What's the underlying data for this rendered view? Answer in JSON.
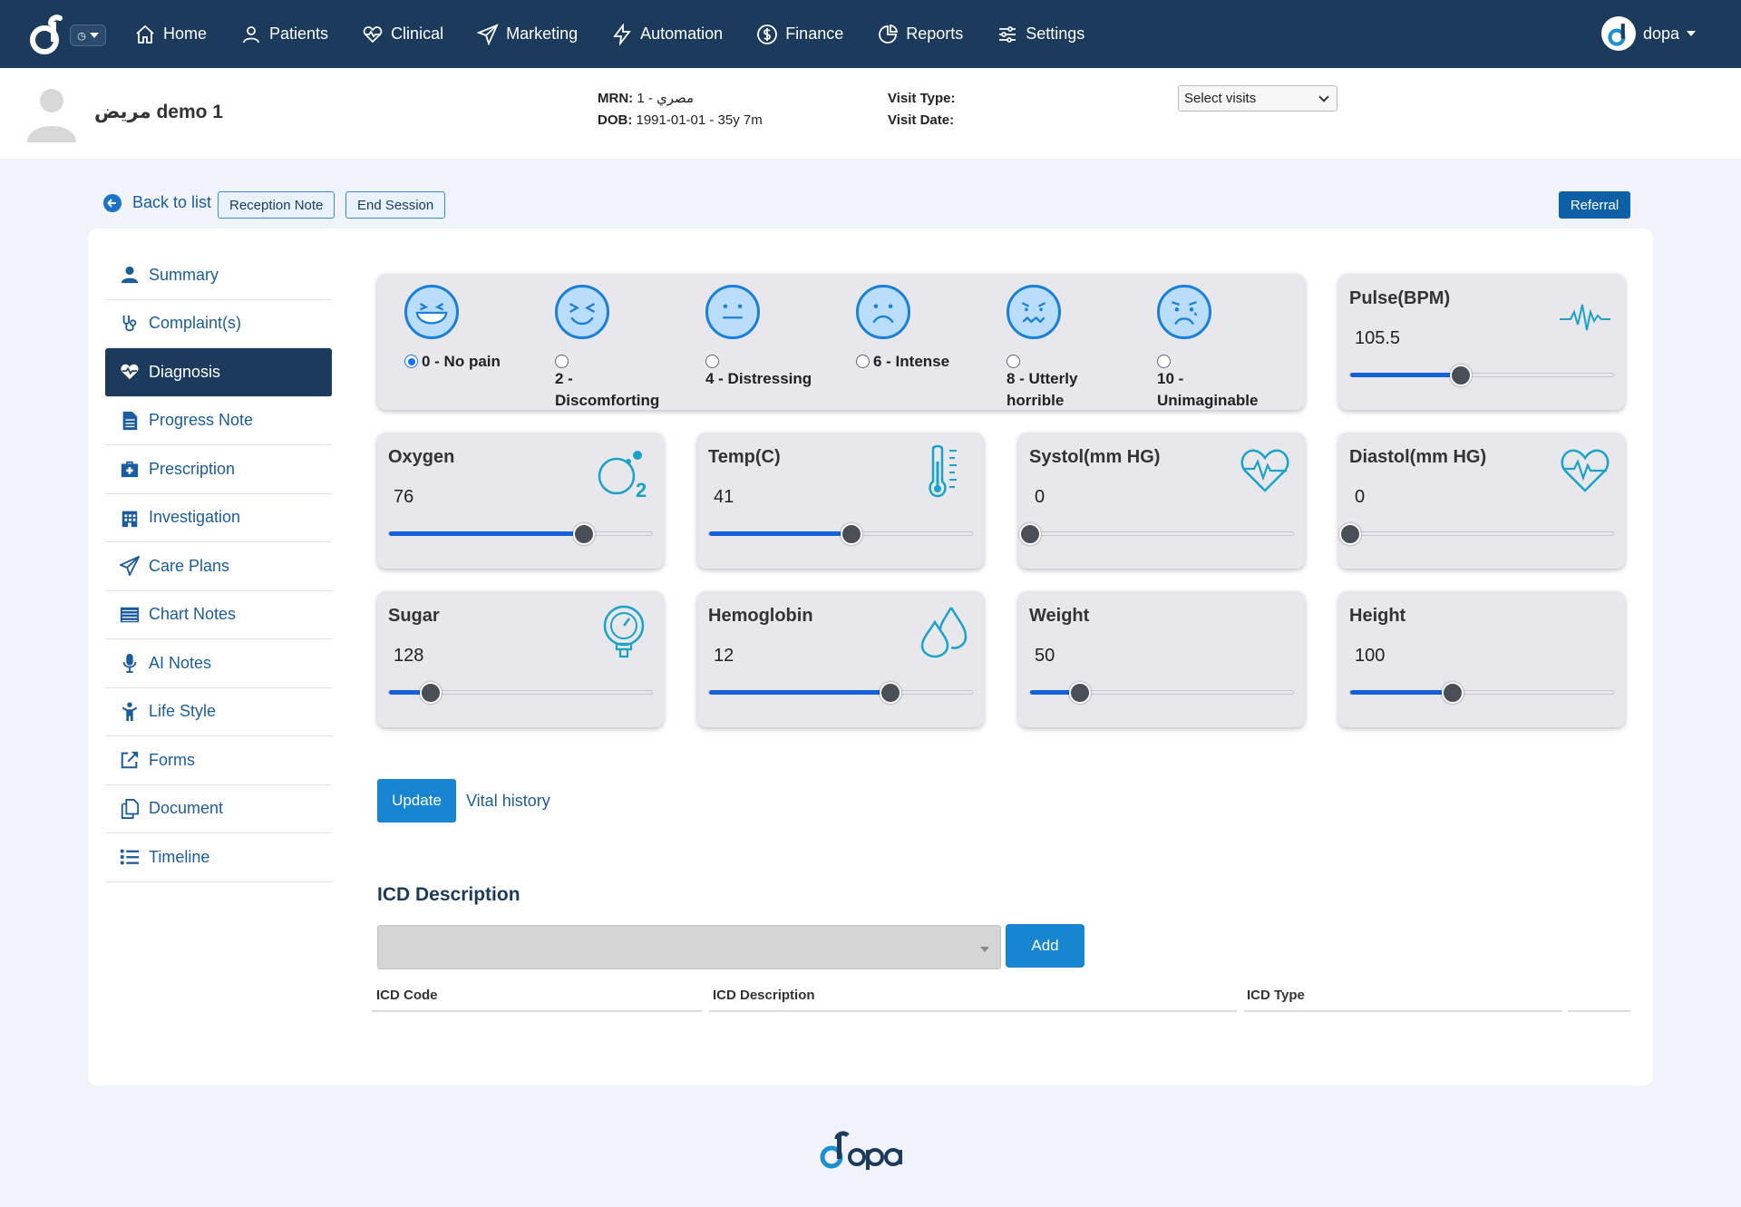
{
  "nav": {
    "items": [
      {
        "label": "Home",
        "icon": "home-icon"
      },
      {
        "label": "Patients",
        "icon": "user-icon"
      },
      {
        "label": "Clinical",
        "icon": "heart-pulse-icon"
      },
      {
        "label": "Marketing",
        "icon": "paper-plane-icon"
      },
      {
        "label": "Automation",
        "icon": "bolt-icon"
      },
      {
        "label": "Finance",
        "icon": "dollar-icon"
      },
      {
        "label": "Reports",
        "icon": "pie-chart-icon"
      },
      {
        "label": "Settings",
        "icon": "sliders-icon"
      }
    ],
    "user": "dopa"
  },
  "patient": {
    "name": "مريض demo 1",
    "mrn_label": "MRN:",
    "mrn_value": "1 - مصري",
    "dob_label": "DOB:",
    "dob_value": "1991-01-01 - 35y 7m",
    "visit_type_label": "Visit Type:",
    "visit_date_label": "Visit Date:",
    "visit_select": "Select visits"
  },
  "actions": {
    "back": "Back to list",
    "reception_note": "Reception Note",
    "end_session": "End Session",
    "referral": "Referral"
  },
  "sidebar": {
    "items": [
      {
        "label": "Summary",
        "icon": "person-icon",
        "active": false
      },
      {
        "label": "Complaint(s)",
        "icon": "stethoscope-icon",
        "active": false
      },
      {
        "label": "Diagnosis",
        "icon": "heart-pulse-icon",
        "active": true
      },
      {
        "label": "Progress Note",
        "icon": "document-icon",
        "active": false
      },
      {
        "label": "Prescription",
        "icon": "medkit-icon",
        "active": false
      },
      {
        "label": "Investigation",
        "icon": "hospital-icon",
        "active": false
      },
      {
        "label": "Care Plans",
        "icon": "paper-plane-icon",
        "active": false
      },
      {
        "label": "Chart Notes",
        "icon": "list-box-icon",
        "active": false
      },
      {
        "label": "AI Notes",
        "icon": "microphone-icon",
        "active": false
      },
      {
        "label": "Life Style",
        "icon": "child-icon",
        "active": false
      },
      {
        "label": "Forms",
        "icon": "external-link-icon",
        "active": false
      },
      {
        "label": "Document",
        "icon": "copy-icon",
        "active": false
      },
      {
        "label": "Timeline",
        "icon": "list-icon",
        "active": false
      }
    ]
  },
  "pain_scale": {
    "selected": "0 - No pain",
    "options": [
      {
        "label": "0 - No pain",
        "line1": "0 - No pain",
        "line2": ""
      },
      {
        "label": "2 - Discomforting",
        "line1": "2 -",
        "line2": "Discomforting"
      },
      {
        "label": "4 - Distressing",
        "line1": "4 - Distressing",
        "line2": ""
      },
      {
        "label": "6 - Intense",
        "line1": "6 - Intense",
        "line2": ""
      },
      {
        "label": "8 - Utterly horrible",
        "line1": "8 - Utterly",
        "line2": "horrible"
      },
      {
        "label": "10 - Unimaginable",
        "line1": "10 -",
        "line2": "Unimaginable"
      }
    ]
  },
  "vitals": {
    "pulse": {
      "title": "Pulse(BPM)",
      "value": "105.5",
      "level": 0.42,
      "icon": "heartbeat-line-icon"
    },
    "oxygen": {
      "title": "Oxygen",
      "value": "76",
      "level": 0.74,
      "icon": "oxygen-o2-icon"
    },
    "temp": {
      "title": "Temp(C)",
      "value": "41",
      "level": 0.54,
      "icon": "thermometer-icon"
    },
    "systol": {
      "title": "Systol(mm HG)",
      "value": "0",
      "level": 0.0,
      "icon": "heart-rate-icon"
    },
    "diastol": {
      "title": "Diastol(mm HG)",
      "value": "0",
      "level": 0.0,
      "icon": "heart-rate-icon"
    },
    "sugar": {
      "title": "Sugar",
      "value": "128",
      "level": 0.16,
      "icon": "glucose-gauge-icon"
    },
    "hemoglobin": {
      "title": "Hemoglobin",
      "value": "12",
      "level": 0.69,
      "icon": "drops-icon"
    },
    "weight": {
      "title": "Weight",
      "value": "50",
      "level": 0.19,
      "icon": "none"
    },
    "height": {
      "title": "Height",
      "value": "100",
      "level": 0.39,
      "icon": "none"
    }
  },
  "buttons": {
    "update": "Update",
    "vital_history": "Vital history",
    "add": "Add"
  },
  "icd": {
    "title": "ICD Description",
    "columns": [
      "ICD Code",
      "ICD Description",
      "ICD Type",
      ""
    ]
  },
  "colors": {
    "navy": "#1b3a5c",
    "accent": "#1785d2",
    "slider": "#1462d9",
    "icon_teal": "#1aa3c8"
  }
}
